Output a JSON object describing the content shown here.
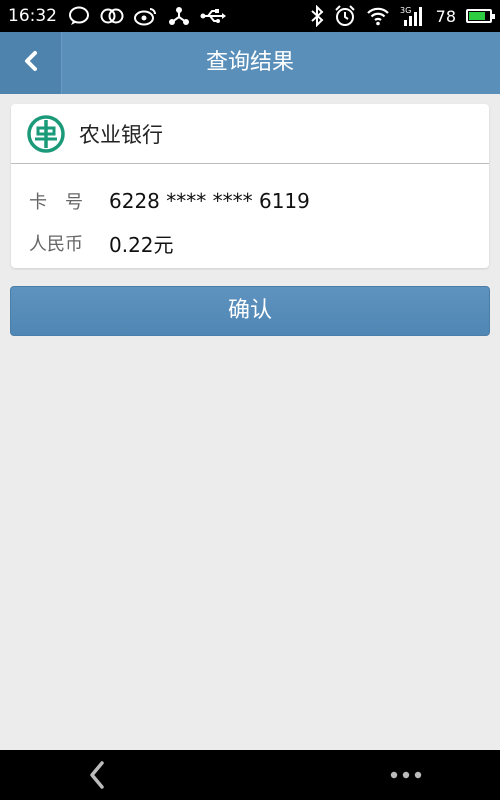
{
  "status_bar": {
    "time": "16:32",
    "battery_level": "78",
    "battery_fraction": 0.78,
    "left_icons": [
      "chat-bubble-icon",
      "qq-icon",
      "weibo-icon",
      "sync-icon",
      "usb-icon"
    ],
    "right_icons": [
      "bluetooth-icon",
      "alarm-icon",
      "wifi-icon",
      "signal-3g-icon",
      "battery-icon"
    ],
    "network_type": "3G"
  },
  "header": {
    "title": "查询结果",
    "back_icon": "chevron-left-icon"
  },
  "card": {
    "bank_name": "农业银行",
    "bank_logo": "abc-bank-logo",
    "card_label": "卡　号",
    "card_number": "6228 **** **** 6119",
    "currency_label": "人民币",
    "balance": "0.22元"
  },
  "confirm_button": {
    "label": "确认"
  },
  "bottom_nav": {
    "back_icon": "back-arrow-icon",
    "more_icon": "more-dots-icon"
  },
  "colors": {
    "header_bg": "#5a8fba",
    "button_bg": "#5a8fba",
    "page_bg": "#ececec",
    "bank_green": "#1a9a78"
  }
}
